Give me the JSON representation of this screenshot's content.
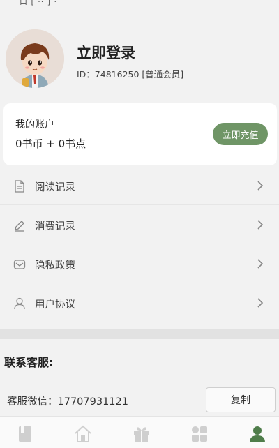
{
  "status_bar": {
    "text": "口 [ ·· ] ·"
  },
  "profile": {
    "login_title": "立即登录",
    "user_id": "ID：74816250 [普通会员]"
  },
  "account": {
    "label": "我的账户",
    "balance": "0书币 + 0书点",
    "recharge_label": "立即充值"
  },
  "menu": {
    "items": [
      {
        "label": "阅读记录",
        "icon": "document-icon"
      },
      {
        "label": "消费记录",
        "icon": "pencil-icon"
      },
      {
        "label": "隐私政策",
        "icon": "envelope-icon"
      },
      {
        "label": "用户协议",
        "icon": "user-icon"
      }
    ]
  },
  "contact": {
    "title": "联系客服:",
    "wechat": "客服微信：17707931121",
    "copy_label": "复制"
  },
  "tabbar": {
    "tabs": [
      {
        "icon": "bookshelf-icon",
        "active": false
      },
      {
        "icon": "home-icon",
        "active": false
      },
      {
        "icon": "gift-icon",
        "active": false
      },
      {
        "icon": "category-icon",
        "active": false
      },
      {
        "icon": "profile-icon",
        "active": true
      }
    ]
  },
  "colors": {
    "accent": "#6f9566",
    "inactive_tab": "#cfcfcf",
    "active_tab": "#4f7d4a"
  }
}
